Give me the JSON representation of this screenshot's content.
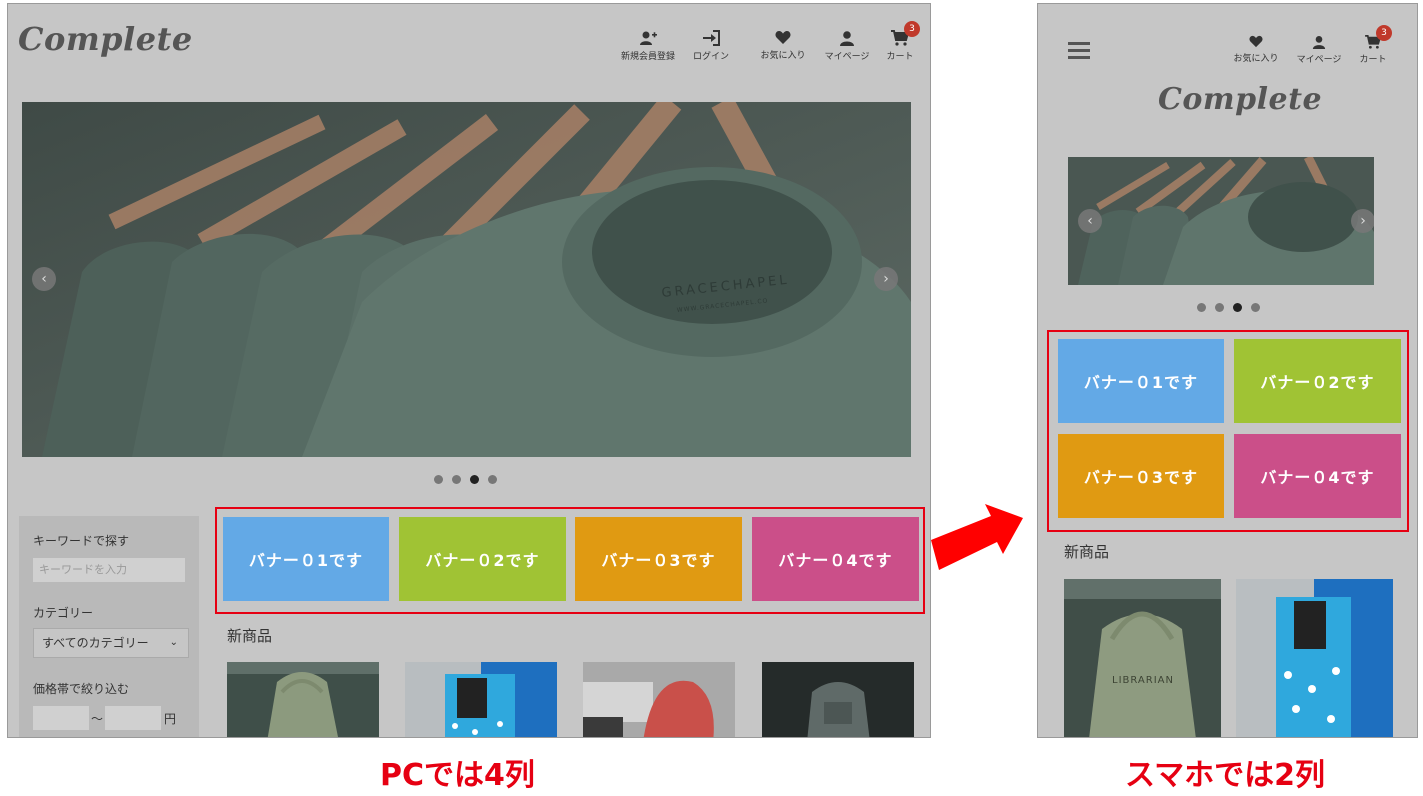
{
  "pc": {
    "logo": "Complete",
    "header_items": [
      {
        "label": "新規会員登録",
        "icon": "user-plus-icon"
      },
      {
        "label": "ログイン",
        "icon": "login-icon"
      },
      {
        "label": "お気に入り",
        "icon": "heart-icon"
      },
      {
        "label": "マイページ",
        "icon": "user-icon"
      },
      {
        "label": "カート",
        "icon": "cart-icon"
      }
    ],
    "cart_count": "3",
    "hero_text": "GRACECHAPEL",
    "hero_subtext": "WWW.GRACECHAPEL.CO",
    "slider_dots": 4,
    "active_dot": 3,
    "banners": [
      {
        "label": "バナー０1です",
        "color": "#63a9e6"
      },
      {
        "label": "バナー０2です",
        "color": "#a0c334"
      },
      {
        "label": "バナー０3です",
        "color": "#e09a12"
      },
      {
        "label": "バナー０4です",
        "color": "#cb4f89"
      }
    ],
    "sidebar": {
      "keyword_label": "キーワードで探す",
      "keyword_placeholder": "キーワードを入力",
      "category_label": "カテゴリー",
      "category_value": "すべてのカテゴリー",
      "price_label": "価格帯で絞り込む",
      "price_separator": "〜",
      "price_unit": "円"
    },
    "new_items_title": "新商品"
  },
  "sp": {
    "logo": "Complete",
    "header_items": [
      {
        "label": "お気に入り",
        "icon": "heart-icon"
      },
      {
        "label": "マイページ",
        "icon": "user-icon"
      },
      {
        "label": "カート",
        "icon": "cart-icon"
      }
    ],
    "cart_count": "3",
    "slider_dots": 4,
    "active_dot": 3,
    "banners": [
      {
        "label": "バナー０1です",
        "color": "#63a9e6"
      },
      {
        "label": "バナー０2です",
        "color": "#a0c334"
      },
      {
        "label": "バナー０3です",
        "color": "#e09a12"
      },
      {
        "label": "バナー０4です",
        "color": "#cb4f89"
      }
    ],
    "new_items_title": "新商品",
    "thumb_text": "LIBRARIAN"
  },
  "captions": {
    "pc": "PCでは4列",
    "sp": "スマホでは2列"
  },
  "colors": {
    "highlight": "#e60012",
    "panel_bg": "#c6c6c6"
  }
}
